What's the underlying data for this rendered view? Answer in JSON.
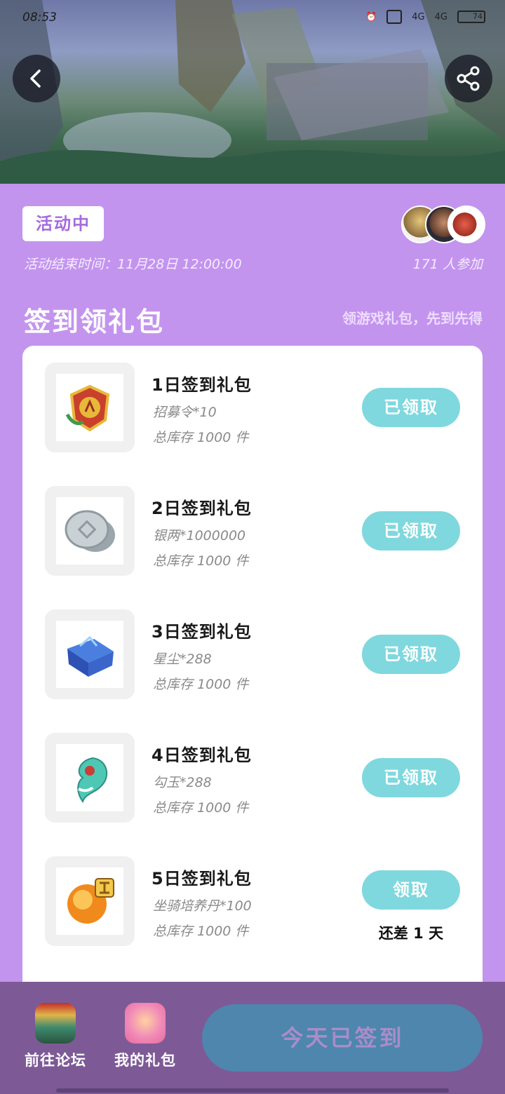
{
  "status_bar": {
    "time": "08:53",
    "network_left": "4G",
    "network_right": "4G",
    "battery": "74"
  },
  "header": {
    "back_icon": "chevron-left-icon",
    "share_icon": "share-icon"
  },
  "activity": {
    "status_badge": "活动中",
    "end_time": "活动结束时间：11月28日 12:00:00",
    "participants": "171 人参加"
  },
  "section": {
    "title": "签到领礼包",
    "subtitle": "领游戏礼包，先到先得"
  },
  "gifts": [
    {
      "name": "1日签到礼包",
      "desc": "招募令*10",
      "stock": "总库存 1000 件",
      "button": "已领取"
    },
    {
      "name": "2日签到礼包",
      "desc": "银两*1000000",
      "stock": "总库存 1000 件",
      "button": "已领取"
    },
    {
      "name": "3日签到礼包",
      "desc": "星尘*288",
      "stock": "总库存 1000 件",
      "button": "已领取"
    },
    {
      "name": "4日签到礼包",
      "desc": "勾玉*288",
      "stock": "总库存 1000 件",
      "button": "已领取"
    },
    {
      "name": "5日签到礼包",
      "desc": "坐骑培养丹*100",
      "stock": "总库存 1000 件",
      "button": "领取",
      "remaining": "还差 1 天"
    }
  ],
  "bottom": {
    "forum_label": "前往论坛",
    "mygifts_label": "我的礼包",
    "signed_label": "今天已签到"
  },
  "colors": {
    "background": "#c394ee",
    "button": "#7fd8de",
    "bottom_bar": "#7d5a96",
    "signed_button": "#4e86ad"
  }
}
